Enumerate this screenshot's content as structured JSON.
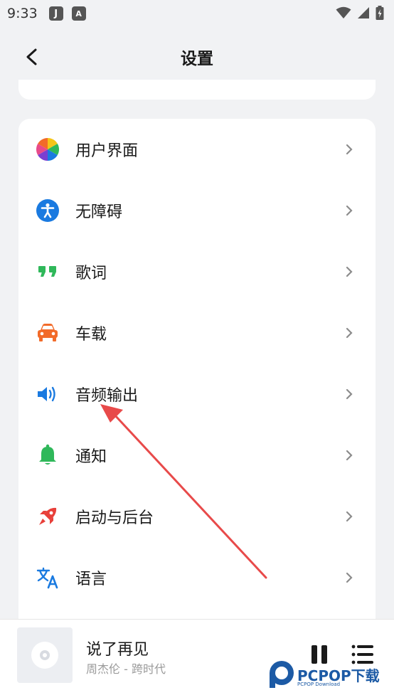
{
  "status_bar": {
    "time": "9:33",
    "app_icons": [
      "J",
      "A"
    ]
  },
  "header": {
    "title": "设置"
  },
  "settings_items": [
    {
      "label": "用户界面",
      "icon": "color-wheel-icon"
    },
    {
      "label": "无障碍",
      "icon": "accessibility-icon"
    },
    {
      "label": "歌词",
      "icon": "quote-icon"
    },
    {
      "label": "车载",
      "icon": "car-icon"
    },
    {
      "label": "音频输出",
      "icon": "speaker-icon"
    },
    {
      "label": "通知",
      "icon": "bell-icon"
    },
    {
      "label": "启动与后台",
      "icon": "rocket-icon"
    },
    {
      "label": "语言",
      "icon": "translate-icon"
    }
  ],
  "player": {
    "title": "说了再见",
    "artist": "周杰伦 - 跨时代"
  },
  "watermark": {
    "text": "PCPOP下载",
    "sub": "PCPOP Download"
  },
  "colors": {
    "background": "#f1f2f4",
    "accessibility_blue": "#1a7ae0",
    "lyrics_green": "#2fb85a",
    "car_orange": "#f26b2a",
    "speaker_blue": "#1a7ae0",
    "bell_green": "#2fb85a",
    "rocket_red": "#e8403a",
    "translate_blue": "#1a7ae0",
    "annotation_red": "#e84a4a"
  }
}
